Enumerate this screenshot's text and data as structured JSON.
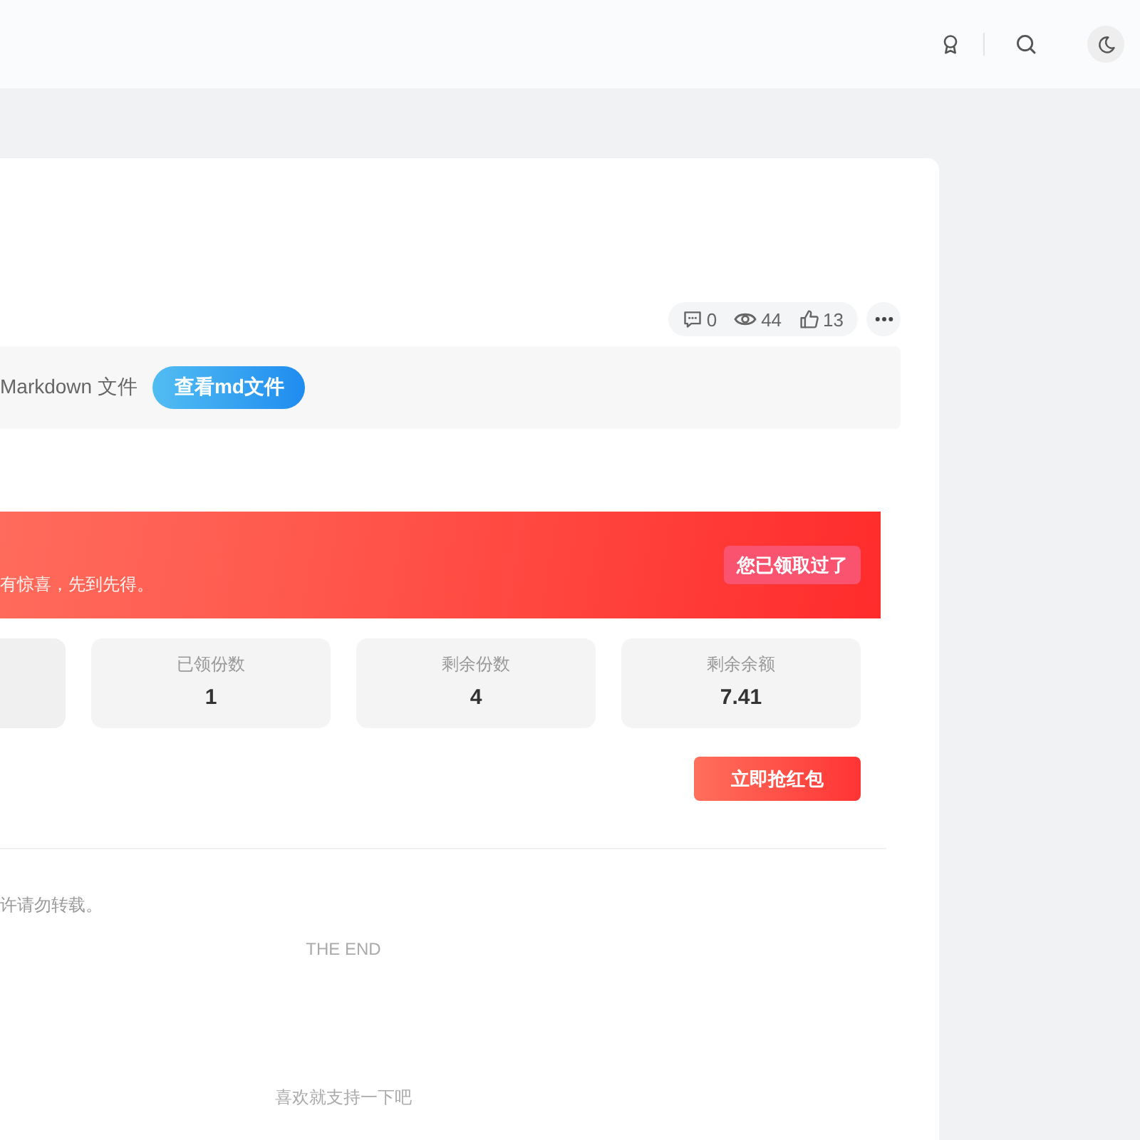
{
  "post_meta": {
    "comments": "0",
    "views": "44",
    "likes": "13"
  },
  "attachment": {
    "text": "Markdown 文件",
    "button": "查看md文件"
  },
  "red_packet": {
    "banner_text": "有惊喜，先到先得。",
    "status_button": "您已领取过了",
    "stats": [
      {
        "label": "已领份数",
        "value": "1"
      },
      {
        "label": "剩余份数",
        "value": "4"
      },
      {
        "label": "剩余余额",
        "value": "7.41"
      }
    ],
    "grab_button": "立即抢红包"
  },
  "article_footer": {
    "copyright_text": "许请勿转载。",
    "end_text": "THE END",
    "support_text": "喜欢就支持一下吧"
  }
}
